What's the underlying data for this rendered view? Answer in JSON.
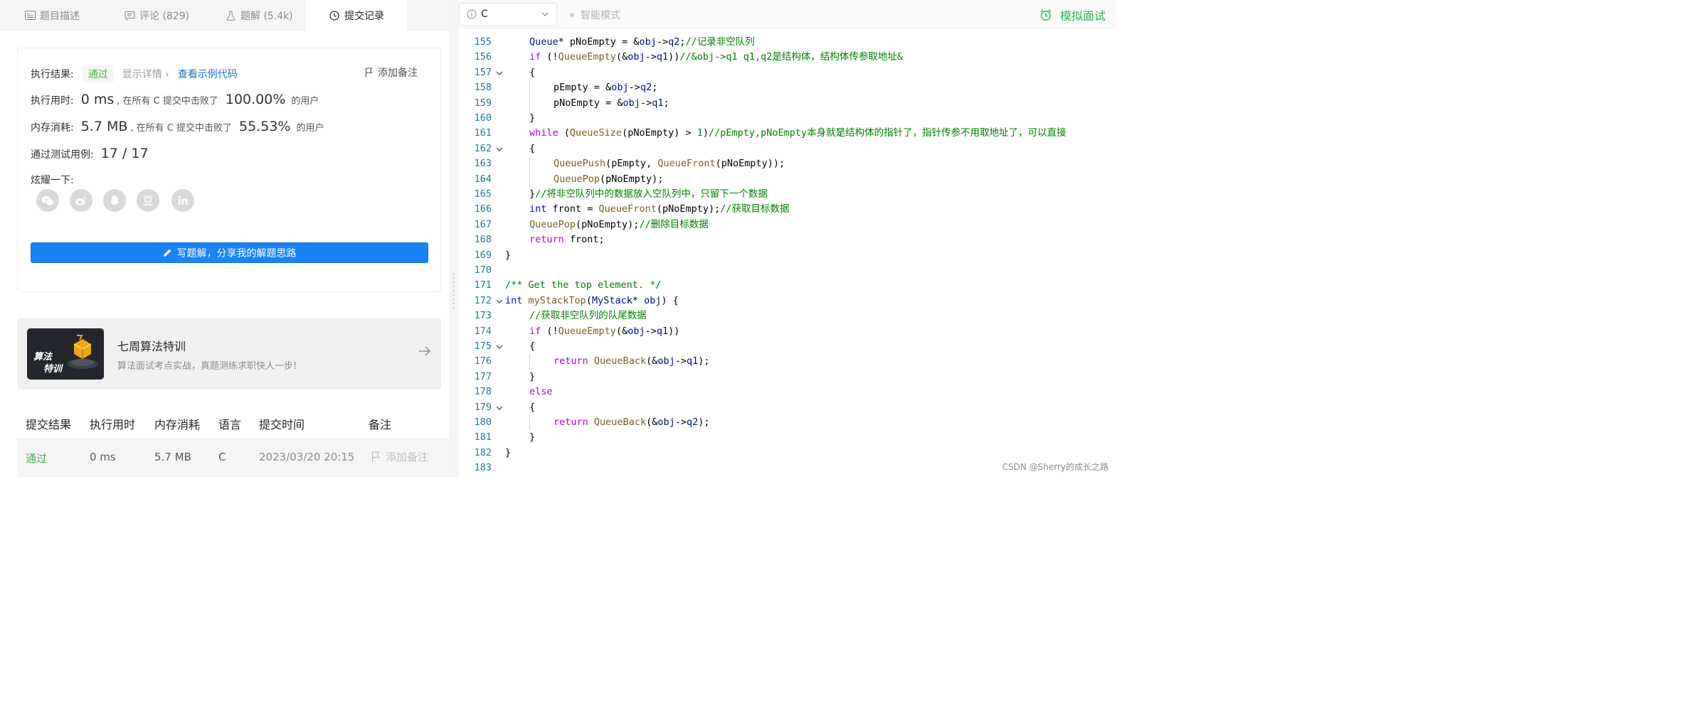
{
  "tabs": [
    {
      "label": "题目描述",
      "icon": "description-icon"
    },
    {
      "label": "评论 (829)",
      "icon": "comment-icon"
    },
    {
      "label": "题解 (5.4k)",
      "icon": "flask-icon"
    },
    {
      "label": "提交记录",
      "icon": "clock-icon",
      "active": true
    }
  ],
  "result": {
    "status_label": "执行结果:",
    "status": "通过",
    "details_link": "显示详情 ›",
    "sample_code_link": "查看示例代码",
    "add_note": "添加备注",
    "runtime_label": "执行用时:",
    "runtime_value": "0 ms",
    "runtime_text": ", 在所有 C 提交中击败了",
    "runtime_percent": "100.00%",
    "runtime_suffix": "的用户",
    "memory_label": "内存消耗:",
    "memory_value": "5.7 MB",
    "memory_text": ", 在所有 C 提交中击败了",
    "memory_percent": "55.53%",
    "memory_suffix": "的用户",
    "tests_label": "通过测试用例:",
    "tests_value": "17 / 17",
    "share_label": "炫耀一下:",
    "share_icons": [
      "wechat-icon",
      "weibo-icon",
      "qq-icon",
      "douban-icon",
      "linkedin-icon"
    ],
    "write_button": "写题解，分享我的解题思路"
  },
  "promo": {
    "image_text_1": "算法",
    "image_text_2": "特训",
    "title": "七周算法特训",
    "subtitle": "算法面试考点实战，真题测练求职快人一步!"
  },
  "submissions": {
    "headers": [
      "提交结果",
      "执行用时",
      "内存消耗",
      "语言",
      "提交时间",
      "备注"
    ],
    "rows": [
      {
        "result": "通过",
        "runtime": "0 ms",
        "memory": "5.7 MB",
        "lang": "C",
        "time": "2023/03/20 20:15",
        "note": "添加备注"
      }
    ]
  },
  "editor": {
    "language": "C",
    "smart_mode": "智能模式",
    "mock_interview": "模拟面试"
  },
  "code_lines": [
    {
      "n": "155",
      "fold": false,
      "indent": 1,
      "tokens": [
        [
          "vr",
          "Queue"
        ],
        [
          "op",
          "* pNoEmpty = &"
        ],
        [
          "vr",
          "obj"
        ],
        [
          "op",
          "->"
        ],
        [
          "vr",
          "q2"
        ],
        [
          "op",
          ";"
        ],
        [
          "cm",
          "//记录非空队列"
        ]
      ]
    },
    {
      "n": "156",
      "fold": false,
      "indent": 1,
      "tokens": [
        [
          "ctl",
          "if"
        ],
        [
          "op",
          " (!"
        ],
        [
          "fn",
          "QueueEmpty"
        ],
        [
          "op",
          "(&"
        ],
        [
          "vr",
          "obj"
        ],
        [
          "op",
          "->"
        ],
        [
          "vr",
          "q1"
        ],
        [
          "op",
          "))"
        ],
        [
          "cm",
          "//&obj->q1 q1,q2是结构体，结构体传参取地址&"
        ]
      ]
    },
    {
      "n": "157",
      "fold": true,
      "indent": 1,
      "tokens": [
        [
          "op",
          "{"
        ]
      ]
    },
    {
      "n": "158",
      "fold": false,
      "indent": 2,
      "tokens": [
        [
          "op",
          "pEmpty = &"
        ],
        [
          "vr",
          "obj"
        ],
        [
          "op",
          "->"
        ],
        [
          "vr",
          "q2"
        ],
        [
          "op",
          ";"
        ]
      ]
    },
    {
      "n": "159",
      "fold": false,
      "indent": 2,
      "tokens": [
        [
          "op",
          "pNoEmpty = &"
        ],
        [
          "vr",
          "obj"
        ],
        [
          "op",
          "->"
        ],
        [
          "vr",
          "q1"
        ],
        [
          "op",
          ";"
        ]
      ]
    },
    {
      "n": "160",
      "fold": false,
      "indent": 1,
      "tokens": [
        [
          "op",
          "}"
        ]
      ]
    },
    {
      "n": "161",
      "fold": false,
      "indent": 1,
      "tokens": [
        [
          "ctl",
          "while"
        ],
        [
          "op",
          " ("
        ],
        [
          "fn",
          "QueueSize"
        ],
        [
          "op",
          "(pNoEmpty) > "
        ],
        [
          "nm",
          "1"
        ],
        [
          "op",
          ")"
        ],
        [
          "cm",
          "//pEmpty,pNoEmpty本身就是结构体的指针了，指针传参不用取地址了，可以直接"
        ]
      ]
    },
    {
      "n": "162",
      "fold": true,
      "indent": 1,
      "tokens": [
        [
          "op",
          "{"
        ]
      ]
    },
    {
      "n": "163",
      "fold": false,
      "indent": 2,
      "tokens": [
        [
          "fn",
          "QueuePush"
        ],
        [
          "op",
          "(pEmpty, "
        ],
        [
          "fn",
          "QueueFront"
        ],
        [
          "op",
          "(pNoEmpty));"
        ]
      ]
    },
    {
      "n": "164",
      "fold": false,
      "indent": 2,
      "tokens": [
        [
          "fn",
          "QueuePop"
        ],
        [
          "op",
          "(pNoEmpty);"
        ]
      ]
    },
    {
      "n": "165",
      "fold": false,
      "indent": 1,
      "tokens": [
        [
          "op",
          "}"
        ],
        [
          "cm",
          "//将非空队列中的数据放入空队列中，只留下一个数据"
        ]
      ]
    },
    {
      "n": "166",
      "fold": false,
      "indent": 1,
      "tokens": [
        [
          "kw",
          "int"
        ],
        [
          "op",
          " front = "
        ],
        [
          "fn",
          "QueueFront"
        ],
        [
          "op",
          "(pNoEmpty);"
        ],
        [
          "cm",
          "//获取目标数据"
        ]
      ]
    },
    {
      "n": "167",
      "fold": false,
      "indent": 1,
      "tokens": [
        [
          "fn",
          "QueuePop"
        ],
        [
          "op",
          "(pNoEmpty);"
        ],
        [
          "cm",
          "//删除目标数据"
        ]
      ]
    },
    {
      "n": "168",
      "fold": false,
      "indent": 1,
      "tokens": [
        [
          "ctl",
          "return"
        ],
        [
          "op",
          " front;"
        ]
      ]
    },
    {
      "n": "169",
      "fold": false,
      "indent": 0,
      "tokens": [
        [
          "op",
          "}"
        ]
      ]
    },
    {
      "n": "170",
      "fold": false,
      "indent": 0,
      "tokens": []
    },
    {
      "n": "171",
      "fold": false,
      "indent": 0,
      "tokens": [
        [
          "cm",
          "/** Get the top element. */"
        ]
      ]
    },
    {
      "n": "172",
      "fold": true,
      "indent": 0,
      "tokens": [
        [
          "kw",
          "int"
        ],
        [
          "op",
          " "
        ],
        [
          "fn",
          "myStackTop"
        ],
        [
          "op",
          "("
        ],
        [
          "vr",
          "MyStack"
        ],
        [
          "op",
          "* "
        ],
        [
          "vr",
          "obj"
        ],
        [
          "op",
          ") {"
        ]
      ]
    },
    {
      "n": "173",
      "fold": false,
      "indent": 1,
      "tokens": [
        [
          "cm",
          "//获取非空队列的队尾数据"
        ]
      ]
    },
    {
      "n": "174",
      "fold": false,
      "indent": 1,
      "tokens": [
        [
          "ctl",
          "if"
        ],
        [
          "op",
          " (!"
        ],
        [
          "fn",
          "QueueEmpty"
        ],
        [
          "op",
          "(&"
        ],
        [
          "vr",
          "obj"
        ],
        [
          "op",
          "->"
        ],
        [
          "vr",
          "q1"
        ],
        [
          "op",
          "))"
        ]
      ]
    },
    {
      "n": "175",
      "fold": true,
      "indent": 1,
      "tokens": [
        [
          "op",
          "{"
        ]
      ]
    },
    {
      "n": "176",
      "fold": false,
      "indent": 2,
      "tokens": [
        [
          "ctl",
          "return"
        ],
        [
          "op",
          " "
        ],
        [
          "fn",
          "QueueBack"
        ],
        [
          "op",
          "(&"
        ],
        [
          "vr",
          "obj"
        ],
        [
          "op",
          "->"
        ],
        [
          "vr",
          "q1"
        ],
        [
          "op",
          ");"
        ]
      ]
    },
    {
      "n": "177",
      "fold": false,
      "indent": 1,
      "tokens": [
        [
          "op",
          "}"
        ]
      ]
    },
    {
      "n": "178",
      "fold": false,
      "indent": 1,
      "tokens": [
        [
          "ctl",
          "else"
        ]
      ]
    },
    {
      "n": "179",
      "fold": true,
      "indent": 1,
      "tokens": [
        [
          "op",
          "{"
        ]
      ]
    },
    {
      "n": "180",
      "fold": false,
      "indent": 2,
      "tokens": [
        [
          "ctl",
          "return"
        ],
        [
          "op",
          " "
        ],
        [
          "fn",
          "QueueBack"
        ],
        [
          "op",
          "(&"
        ],
        [
          "vr",
          "obj"
        ],
        [
          "op",
          "->"
        ],
        [
          "vr",
          "q2"
        ],
        [
          "op",
          ");"
        ]
      ]
    },
    {
      "n": "181",
      "fold": false,
      "indent": 1,
      "tokens": [
        [
          "op",
          "}"
        ]
      ]
    },
    {
      "n": "182",
      "fold": false,
      "indent": 0,
      "tokens": [
        [
          "op",
          "}"
        ]
      ]
    },
    {
      "n": "183",
      "fold": false,
      "indent": 0,
      "tokens": []
    }
  ],
  "watermark": "CSDN @Sherry的成长之路"
}
